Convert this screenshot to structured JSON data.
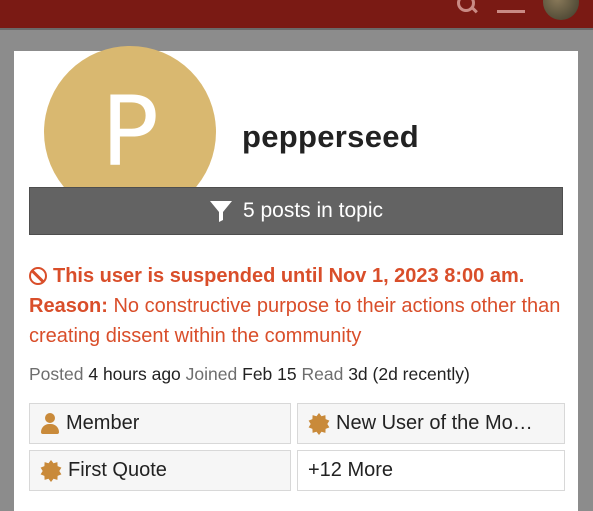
{
  "header": {
    "icons": [
      "search-icon",
      "menu-icon",
      "user-avatar"
    ]
  },
  "profile": {
    "avatar_letter": "P",
    "avatar_color": "#d9b870",
    "username": "pepperseed"
  },
  "filter": {
    "icon": "filter-icon",
    "label": "5 posts in topic"
  },
  "suspension": {
    "icon": "ban-icon",
    "headline": "This user is suspended until Nov 1, 2023 8:00 am.",
    "reason_label": "Reason:",
    "reason_text": "No constructive purpose to their actions other than creating dissent within the community",
    "color": "#d94e2a"
  },
  "meta": {
    "posted_label": "Posted",
    "posted_value": "4 hours ago",
    "joined_label": "Joined",
    "joined_value": "Feb 15",
    "read_label": "Read",
    "read_value": "3d (2d recently)"
  },
  "badges": [
    {
      "icon": "person-icon",
      "label": "Member"
    },
    {
      "icon": "certificate-icon",
      "label": "New User of the Mo…"
    },
    {
      "icon": "certificate-icon",
      "label": "First Quote"
    },
    {
      "icon": "",
      "label": "+12 More"
    }
  ],
  "colors": {
    "header_bg": "#7a1a14",
    "badge_icon": "#c98a3a",
    "filter_bg": "#636363"
  }
}
